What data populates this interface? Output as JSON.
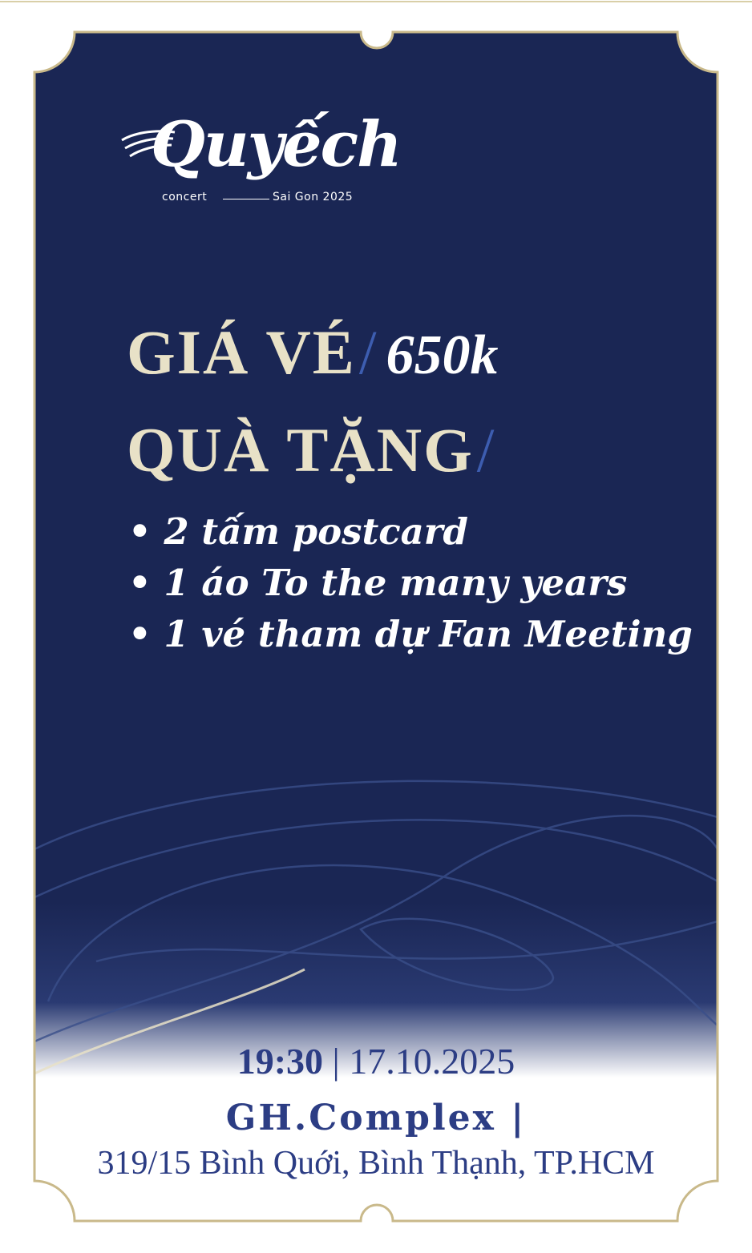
{
  "colors": {
    "navy": "#1a2654",
    "cream": "#e8e1c7",
    "gold_border": "#c9b98a",
    "accent_blue": "#3d5db0",
    "footer_text": "#2c3d84"
  },
  "logo": {
    "word": "Quyếch",
    "sub_left": "concert",
    "sub_right": "Sai Gon 2025"
  },
  "price": {
    "label": "GIÁ VÉ",
    "separator": "/",
    "value": "650k"
  },
  "gifts": {
    "label": "QUÀ TẶNG",
    "separator": "/",
    "items": [
      "• 2  tấm postcard",
      "• 1  áo  To the many years",
      "• 1 vé tham dự Fan Meeting"
    ]
  },
  "event": {
    "time": "19:30",
    "divider": "|",
    "date": "17.10.2025",
    "venue": "GH.Complex |",
    "address": "319/15 Bình Quới, Bình Thạnh, TP.HCM"
  }
}
